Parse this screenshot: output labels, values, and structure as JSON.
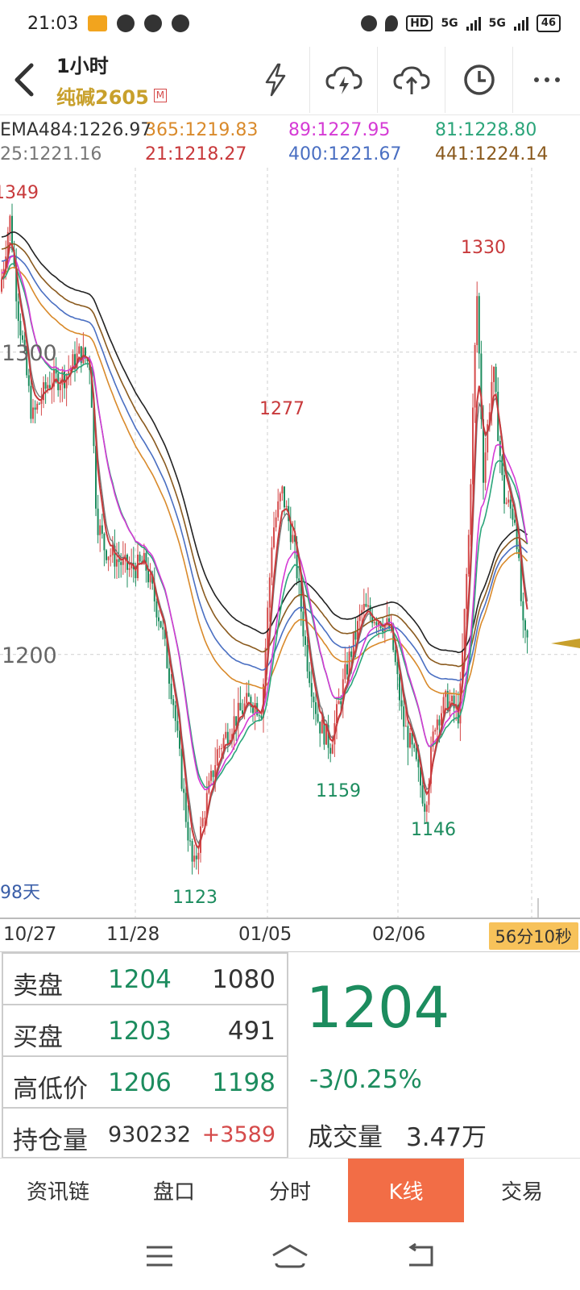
{
  "status_bar": {
    "time": "21:03",
    "network_1": "5G",
    "network_2": "5G",
    "hd": "HD",
    "battery": "46"
  },
  "header": {
    "period": "1小时",
    "contract": "纯碱2605",
    "badge": "M"
  },
  "ema_legend": [
    {
      "text": "EMA484:1226.97",
      "color": "#333333"
    },
    {
      "text": "365:1219.83",
      "color": "#d98a2b"
    },
    {
      "text": "89:1227.95",
      "color": "#d53ad5"
    },
    {
      "text": "81:1228.80",
      "color": "#2ba57a"
    },
    {
      "text": "25:1221.16",
      "color": "#777777"
    },
    {
      "text": "21:1218.27",
      "color": "#c8393b"
    },
    {
      "text": "400:1221.67",
      "color": "#4a6fc2"
    },
    {
      "text": "441:1224.14",
      "color": "#8a5a1e"
    }
  ],
  "chart": {
    "y_labels": [
      "1300",
      "1200"
    ],
    "annotations": [
      "1349",
      "1330",
      "1277",
      "1159",
      "1146",
      "1123",
      "98天"
    ],
    "y_range": [
      1113,
      1361
    ]
  },
  "x_axis": {
    "labels": [
      "10/27",
      "11/28",
      "01/05",
      "02/06"
    ],
    "countdown": "56分10秒"
  },
  "quote": {
    "sell": {
      "label": "卖盘",
      "price": "1204",
      "qty": "1080"
    },
    "buy": {
      "label": "买盘",
      "price": "1203",
      "qty": "491"
    },
    "high_low": {
      "label": "高低价",
      "high": "1206",
      "low": "1198"
    },
    "open_interest": {
      "label": "持仓量",
      "value": "930232",
      "change": "+3589"
    },
    "last_price": "1204",
    "change": "-3/0.25%",
    "volume_label": "成交量",
    "volume_value": "3.47万"
  },
  "tabs": [
    {
      "label": "资讯链",
      "active": false
    },
    {
      "label": "盘口",
      "active": false
    },
    {
      "label": "分时",
      "active": false
    },
    {
      "label": "K线",
      "active": true
    },
    {
      "label": "交易",
      "active": false
    }
  ],
  "colors": {
    "up": "#d54a4a",
    "down": "#1c8c5e",
    "accent": "#f26d46",
    "gold": "#c8a02c"
  },
  "icons": [
    "back-arrow-icon",
    "lightning-icon",
    "cloud-lightning-icon",
    "cloud-upload-icon",
    "clock-icon",
    "more-icon",
    "menu-icon",
    "home-icon",
    "return-icon"
  ]
}
